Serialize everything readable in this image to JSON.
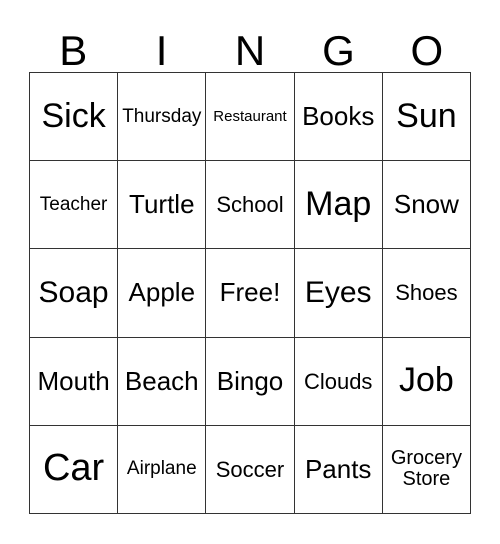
{
  "card": {
    "header_letters": [
      "B",
      "I",
      "N",
      "G",
      "O"
    ],
    "columns": 5,
    "rows": 5,
    "free_space_label": "Free!",
    "colors": {
      "border": "#333333",
      "background": "#ffffff",
      "text": "#000000"
    },
    "cells": [
      [
        {
          "label": "Sick",
          "size": "xl"
        },
        {
          "label": "Thursday",
          "size": "xs"
        },
        {
          "label": "Restaurant",
          "size": "xxs"
        },
        {
          "label": "Books",
          "size": "m"
        },
        {
          "label": "Sun",
          "size": "xl"
        }
      ],
      [
        {
          "label": "Teacher",
          "size": "xs"
        },
        {
          "label": "Turtle",
          "size": "m"
        },
        {
          "label": "School",
          "size": "s"
        },
        {
          "label": "Map",
          "size": "xl"
        },
        {
          "label": "Snow",
          "size": "m"
        }
      ],
      [
        {
          "label": "Soap",
          "size": "l"
        },
        {
          "label": "Apple",
          "size": "m"
        },
        {
          "label": "Free!",
          "size": "m"
        },
        {
          "label": "Eyes",
          "size": "l"
        },
        {
          "label": "Shoes",
          "size": "s"
        }
      ],
      [
        {
          "label": "Mouth",
          "size": "m"
        },
        {
          "label": "Beach",
          "size": "m"
        },
        {
          "label": "Bingo",
          "size": "m"
        },
        {
          "label": "Clouds",
          "size": "s"
        },
        {
          "label": "Job",
          "size": "xl"
        }
      ],
      [
        {
          "label": "Car",
          "size": "xxl"
        },
        {
          "label": "Airplane",
          "size": "xs"
        },
        {
          "label": "Soccer",
          "size": "s"
        },
        {
          "label": "Pants",
          "size": "m"
        },
        {
          "label": "Grocery\nStore",
          "size": "two"
        }
      ]
    ]
  }
}
